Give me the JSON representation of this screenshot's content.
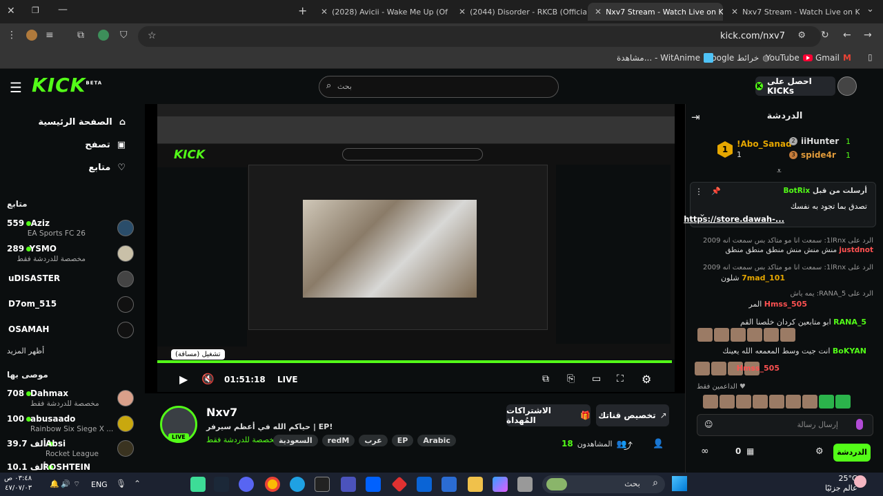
{
  "browser": {
    "tabs": [
      {
        "label": "(2028) Avicii - Wake Me Up (Of",
        "icon": "youtube-icon"
      },
      {
        "label": "(2044) Disorder - RKCB (Official",
        "icon": "youtube-icon"
      },
      {
        "label": "Nxv7 Stream - Watch Live on K",
        "icon": "kick-icon",
        "active": true
      },
      {
        "label": "Nxv7 Stream - Watch Live on K",
        "icon": "kick-icon"
      }
    ],
    "new_tab": "+",
    "url": "kick.com/nxv7",
    "extension_badge": "21",
    "bookmarks": [
      "Gmail",
      "YouTube",
      "Google خرائط",
      "مشاهدة... - WitAnime"
    ]
  },
  "kick": {
    "logo": "KICK",
    "logo_badge": "BETA",
    "search_placeholder": "بحث",
    "get_kicks": "احصل على KICKs",
    "nav": [
      {
        "label": "الصفحة الرئيسية",
        "icon": "home-icon"
      },
      {
        "label": "تصفح",
        "icon": "browse-icon"
      },
      {
        "label": "متابع",
        "icon": "heart-icon"
      }
    ],
    "following_title": "متابع",
    "following": [
      {
        "name": "Aziz",
        "category": "EA Sports FC 26",
        "count": "559",
        "live": true
      },
      {
        "name": "YSMO",
        "category": "مخصصة للدردشة فقط",
        "count": "289",
        "live": true
      },
      {
        "name": "uDISASTER",
        "live": false
      },
      {
        "name": "D7om_515",
        "live": false
      },
      {
        "name": "OSAMAH",
        "live": false
      }
    ],
    "show_more": "أظهر المزيد",
    "recommended_title": "موصى بها",
    "recommended": [
      {
        "name": "Dahmax",
        "category": "مخصصة للدردشة فقط",
        "count": "708"
      },
      {
        "name": "abusaado",
        "category": "Rainbow Six Siege X ...",
        "count": "100"
      },
      {
        "name": "Absi",
        "category": "Rocket League",
        "count": "39.7 ألف"
      },
      {
        "name": "ROSHTEIN",
        "category": "",
        "count": "10.1 ألف"
      }
    ],
    "player": {
      "time": "01:51:18",
      "live": "LIVE",
      "tooltip": "تشغيل (مسافة)"
    },
    "streamer": {
      "name": "Nxv7",
      "title": "حياكم الله في أعظم سيرفر | EP!",
      "category": "مخصصة للدردشة فقط",
      "live_badge": "LIVE",
      "tags": [
        "Arabic",
        "EP",
        "عرب",
        "redM",
        "السعودية"
      ],
      "viewers": "18",
      "viewers_label": "المشاهدون",
      "gift_subs": "الاشتراكات المُهداة",
      "customize_channel": "تخصيص قناتك"
    },
    "chat": {
      "title": "الدردشة",
      "leaderboard": [
        {
          "rank": "1",
          "name": "!Abo_Sanad",
          "count": "1"
        },
        {
          "rank": "2",
          "name": "iiHunter",
          "count": "1"
        },
        {
          "rank": "3",
          "name": "spide4r",
          "count": "1"
        }
      ],
      "pinned_by": "أرسلت من قبل",
      "pinned_user": "BotRix",
      "pinned_text": "تصدق بما تجود به نفسك",
      "pinned_link": "https://store.dawah-...",
      "messages": [
        {
          "reply": "الرد على 1lRnx: سمعت انا مو متاكد بس سمعت انه 2009",
          "user": "justdnot",
          "text": "منش منش منش منطق منطق منطق"
        },
        {
          "reply": "الرد على 1lRnx: سمعت انا مو متاكد بس سمعت انه 2009",
          "user": "7mad_101",
          "text": "شلون"
        },
        {
          "reply": "الرد على 5_RANA: يمه ياش",
          "user": "Hmss_505",
          "text": "المر"
        },
        {
          "reply": "",
          "user": "5_RANA",
          "text": "ابو متابعين كردان خلصنا القم"
        },
        {
          "reply": "",
          "user": "BoKYAN",
          "text": "انت جيت وسط المعمعه الله يعينك"
        },
        {
          "reply": "",
          "user": "Hmss_505",
          "text": ""
        }
      ],
      "supporters": "الداعمين فقط",
      "input_placeholder": "إرسال رسالة",
      "send": "الدردشة",
      "points": "0"
    }
  },
  "taskbar": {
    "search": "بحث",
    "lang": "ENG",
    "time": "٠٣:٤٨ ص",
    "date": "٤٧/٠٧/٠٣",
    "temp": "25°C",
    "weather": "عالم جزئيًا"
  }
}
